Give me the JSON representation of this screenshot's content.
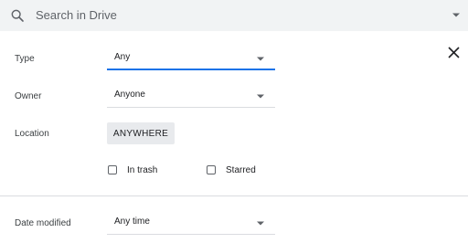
{
  "search": {
    "placeholder": "Search in Drive",
    "icon": "search-icon",
    "options_icon": "caret-down-icon"
  },
  "panel": {
    "close_icon": "close-icon"
  },
  "filters": {
    "type": {
      "label": "Type",
      "value": "Any"
    },
    "owner": {
      "label": "Owner",
      "value": "Anyone"
    },
    "location": {
      "label": "Location",
      "value": "ANYWHERE"
    },
    "in_trash": {
      "label": "In trash",
      "checked": false
    },
    "starred": {
      "label": "Starred",
      "checked": false
    },
    "date_modified": {
      "label": "Date modified",
      "value": "Any time"
    }
  },
  "colors": {
    "accent": "#1a73e8",
    "search_bg": "#f1f3f4",
    "chip_bg": "#e8eaed"
  }
}
